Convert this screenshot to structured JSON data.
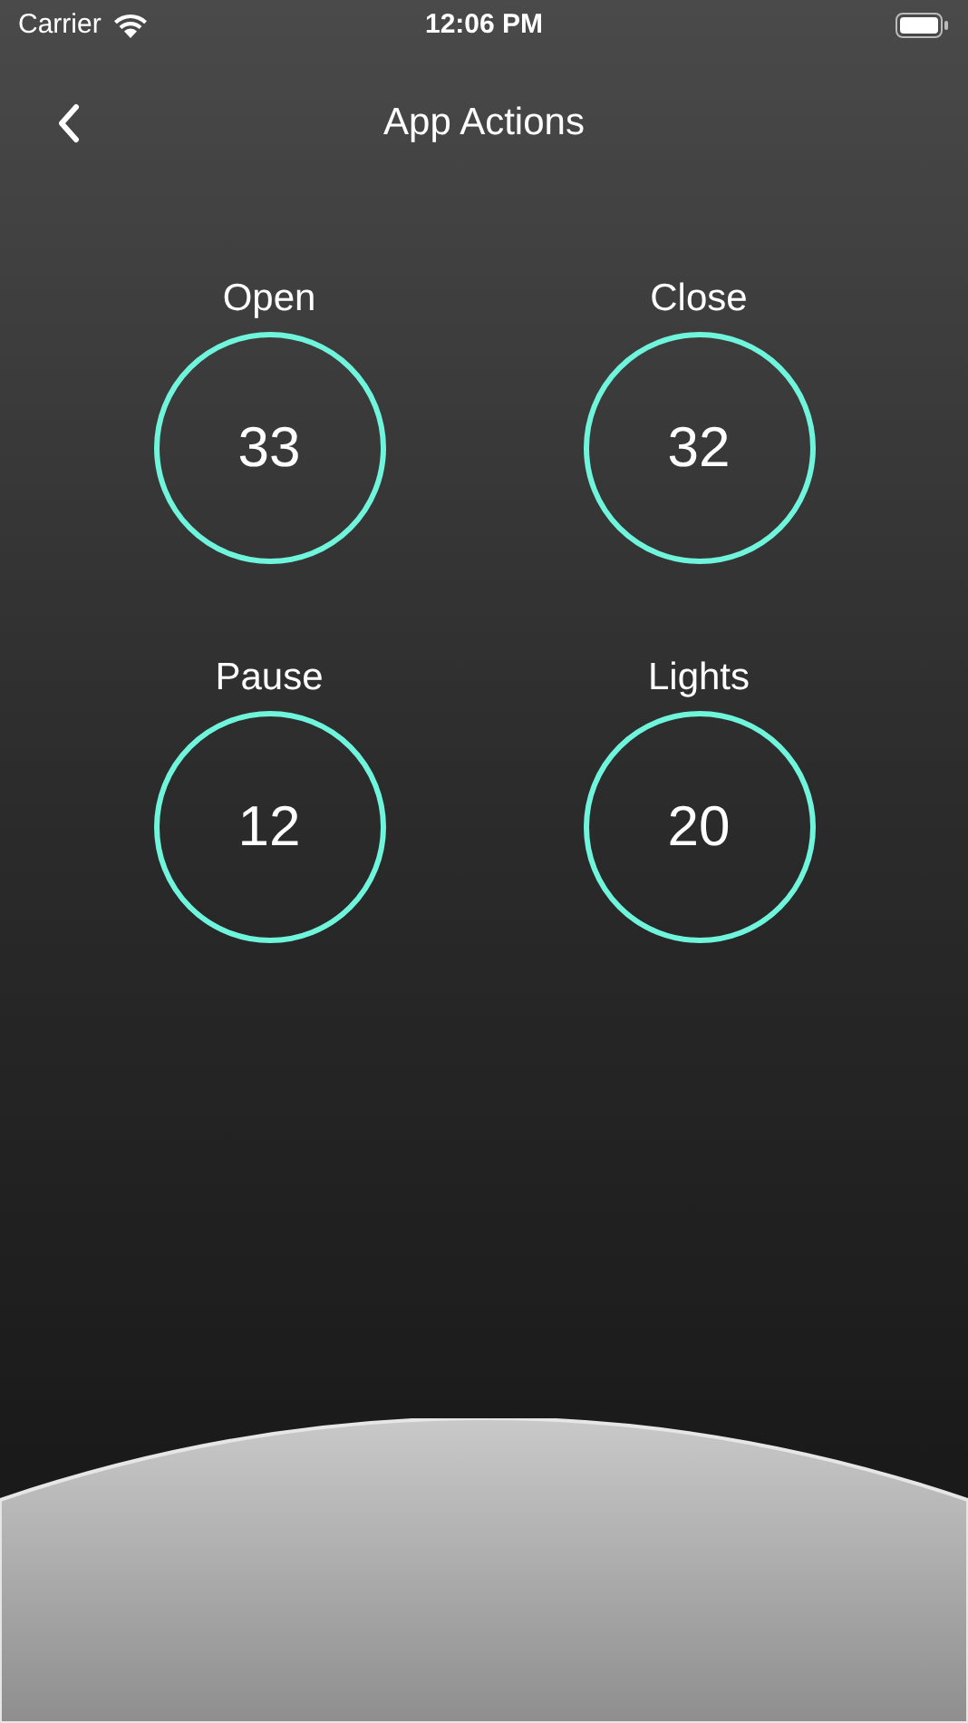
{
  "status_bar": {
    "carrier": "Carrier",
    "time": "12:06 PM"
  },
  "nav": {
    "title": "App Actions"
  },
  "actions": [
    {
      "label": "Open",
      "count": "33"
    },
    {
      "label": "Close",
      "count": "32"
    },
    {
      "label": "Pause",
      "count": "12"
    },
    {
      "label": "Lights",
      "count": "20"
    }
  ]
}
